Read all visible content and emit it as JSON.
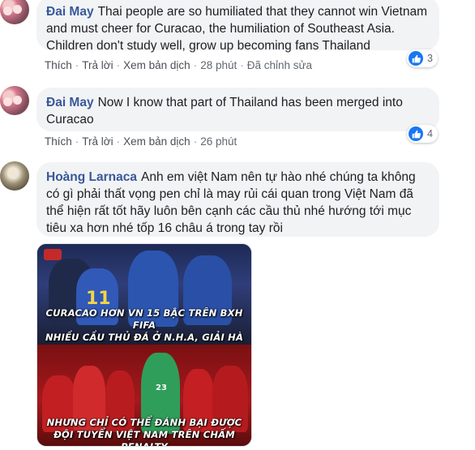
{
  "comments": [
    {
      "author": "Đai May",
      "text": "Thai people are so humiliated that they cannot win Vietnam and must cheer for Curacao, the humiliation of Southeast Asia. Children don't study well, grow up becoming fans Thailand",
      "actions": {
        "like": "Thích",
        "reply": "Trả lời",
        "translate": "Xem bản dịch",
        "time": "28 phút",
        "edited": "Đã chỉnh sửa"
      },
      "reactions": {
        "icon": "like-icon",
        "count": "3"
      }
    },
    {
      "author": "Đai May",
      "text": "Now I know that part of Thailand has been merged into Curacao",
      "actions": {
        "like": "Thích",
        "reply": "Trả lời",
        "translate": "Xem bản dịch",
        "time": "26 phút"
      },
      "reactions": {
        "icon": "like-icon",
        "count": "4"
      }
    },
    {
      "author": "Hoàng Larnaca",
      "text": "Anh em việt Nam nên tự hào nhé chúng ta không có gì phải thất vọng pen chỉ là may rủi cái quan trong Việt Nam đã thể hiện rất tốt hãy luôn bên cạnh các cầu thủ nhé hướng tới mục tiêu xa hơn nhé tốp 16 châu á trong tay rồi",
      "image": {
        "caption_top": "CURACAO HƠN VN 15 BẬC TRÊN BXH FIFA\nNHIỀU CẦU THỦ ĐÁ Ở N.H.A, GIẢI HÀ LAN",
        "caption_bottom": "NHƯNG CHỈ CÓ THỂ ĐÁNH BẠI ĐƯỢC\nĐỘI TUYỂN VIỆT NAM TRÊN CHẤM PENALTY"
      }
    }
  ],
  "colors": {
    "name": "#385898",
    "bubble": "#f2f3f5",
    "like": "#1877f2"
  }
}
